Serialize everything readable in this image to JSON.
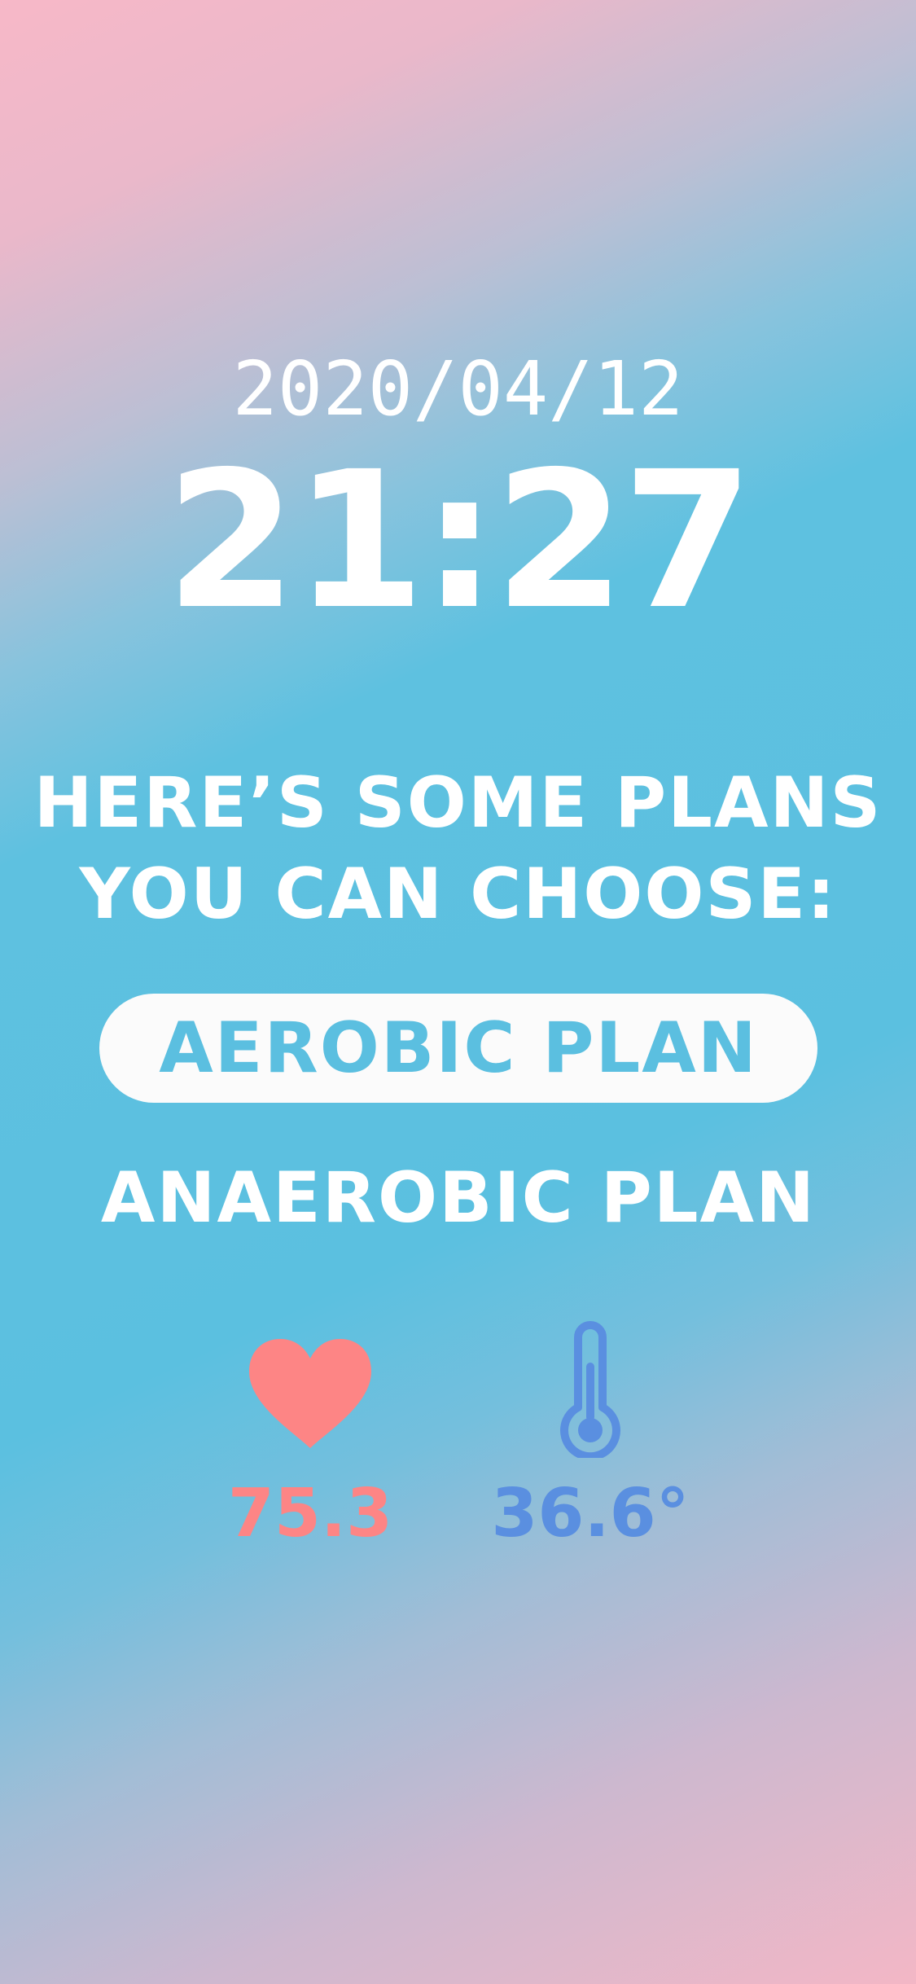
{
  "clock": {
    "date": "2020/04/12",
    "time": "21:27"
  },
  "heading": {
    "line1": "HERE’S SOME PLANS",
    "line2": "YOU CAN CHOOSE:"
  },
  "plans": {
    "aerobic_label": "AEROBIC PLAN",
    "anaerobic_label": "ANAEROBIC PLAN"
  },
  "vitals": {
    "heart_icon": "heart-icon",
    "heart_rate": "75.3",
    "heart_color": "#fd8585",
    "temp_icon": "thermometer-icon",
    "temperature": "36.6°",
    "temp_color": "#5a8fe0"
  },
  "colors": {
    "accent": "#5bc0e0",
    "selected_bg": "#fbfbfb"
  }
}
